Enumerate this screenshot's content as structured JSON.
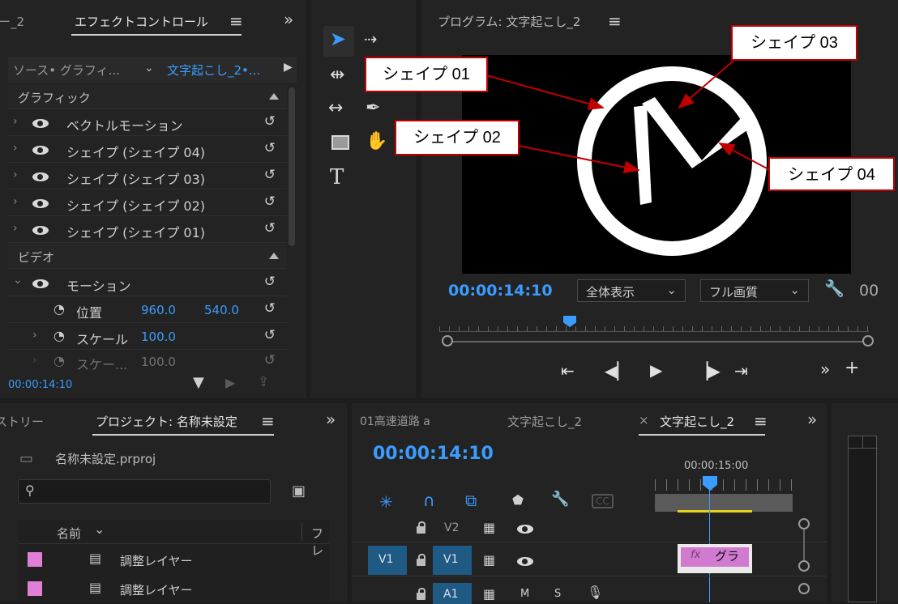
{
  "effects_panel": {
    "left_tab": "ー_2",
    "tab": "エフェクトコントロール",
    "menu_icon": "≡",
    "source_label": "ソース• グラフィ...",
    "sequence_label": "文字起こし_2•...",
    "section_graphic": "グラフィック",
    "rows": [
      {
        "label": "ベクトルモーション"
      },
      {
        "label": "シェイプ (シェイプ 04)"
      },
      {
        "label": "シェイプ (シェイプ 03)"
      },
      {
        "label": "シェイプ (シェイプ 02)"
      },
      {
        "label": "シェイプ (シェイプ 01)"
      }
    ],
    "section_video": "ビデオ",
    "motion_label": "モーション",
    "position_label": "位置",
    "position_x": "960.0",
    "position_y": "540.0",
    "scale_label": "スケール",
    "scale_value": "100.0",
    "scale2_label": "スケー...",
    "scale2_value": "100.0",
    "timecode": "00:00:14:10"
  },
  "program_monitor": {
    "title": "プログラム: 文字起こし_2",
    "menu_icon": "≡",
    "timecode": "00:00:14:10",
    "fit_label": "全体表示",
    "quality_label": "フル画質",
    "extra": "00"
  },
  "callouts": {
    "shape01": "シェイプ 01",
    "shape02": "シェイプ 02",
    "shape03": "シェイプ 03",
    "shape04": "シェイプ 04"
  },
  "project_panel": {
    "left_tab": "ストリー",
    "tab": "プロジェクト: 名称未設定",
    "menu_icon": "≡",
    "file": "名称未設定.prproj",
    "col_name": "名前",
    "col_fr": "フレ",
    "items": [
      {
        "label": "調整レイヤー",
        "color": "#e07fd6"
      },
      {
        "label": "調整レイヤー",
        "color": "#e07fd6"
      }
    ]
  },
  "timeline": {
    "tab1": "01高速道路 a",
    "tab2": "文字起こし_2",
    "tab3": "文字起こし_2",
    "close": "×",
    "menu_icon": "≡",
    "timecode": "00:00:14:10",
    "ruler_time": "00:00:15:00",
    "v2": "V2",
    "v1_src": "V1",
    "v1": "V1",
    "a1": "A1",
    "m": "M",
    "s": "S",
    "clip_fx": "fx",
    "clip_label": "グラ"
  },
  "colors": {
    "accent": "#3b9cff",
    "callout_border": "#c00000",
    "clip": "#e07fd6"
  }
}
